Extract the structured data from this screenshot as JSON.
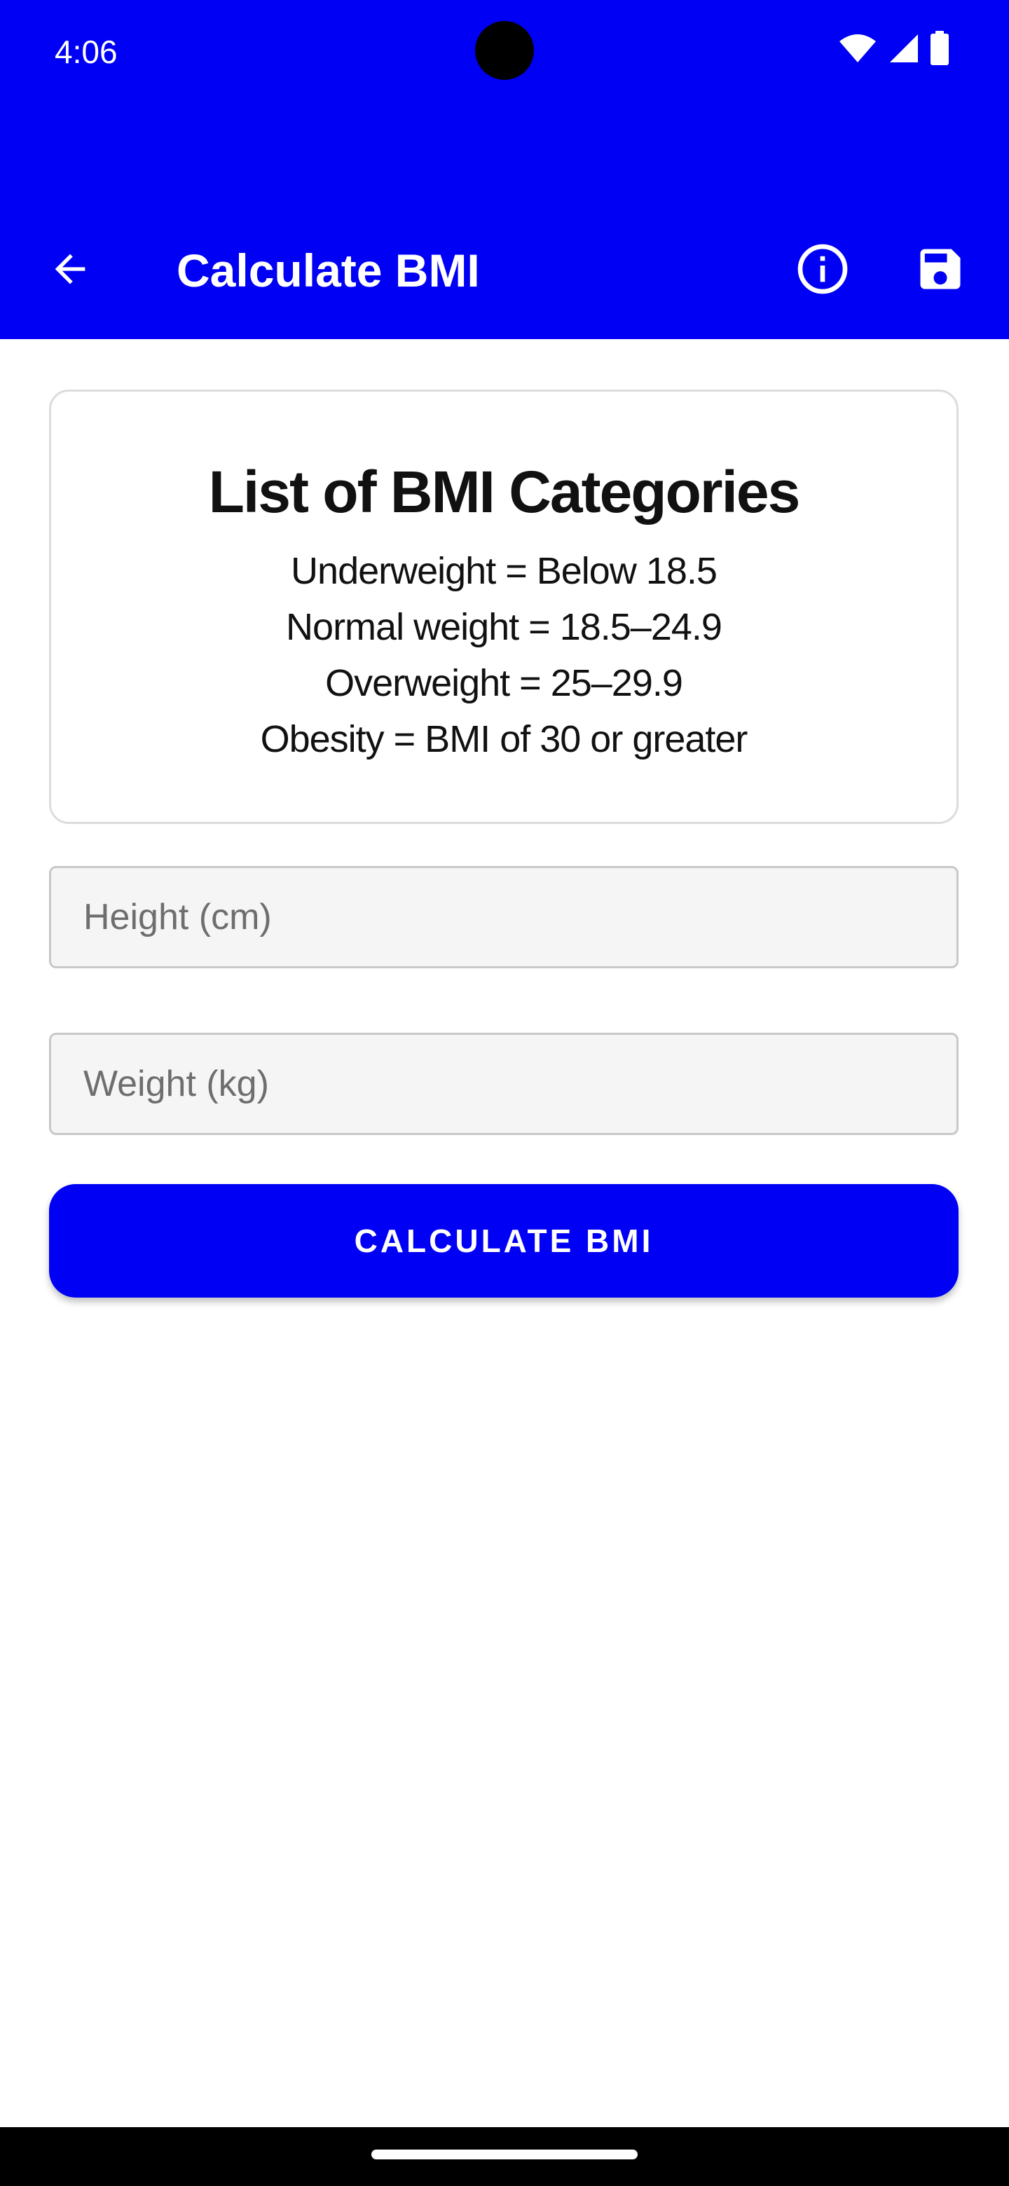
{
  "status_bar": {
    "time": "4:06",
    "icons": [
      "wifi-icon",
      "signal-icon",
      "battery-icon"
    ]
  },
  "app_bar": {
    "title": "Calculate BMI",
    "icons": [
      "back-arrow-icon",
      "info-icon",
      "save-icon"
    ]
  },
  "categories_card": {
    "title": "List of BMI Categories",
    "lines": [
      "Underweight = Below 18.5",
      "Normal weight = 18.5–24.9",
      "Overweight = 25–29.9",
      "Obesity = BMI of 30 or greater"
    ]
  },
  "form": {
    "height_placeholder": "Height (cm)",
    "weight_placeholder": "Weight (kg)",
    "height_value": "",
    "weight_value": "",
    "calculate_label": "CALCULATE BMI"
  },
  "colors": {
    "primary": "#0000f5",
    "on_primary": "#ffffff",
    "field_background": "#f5f5f5"
  }
}
